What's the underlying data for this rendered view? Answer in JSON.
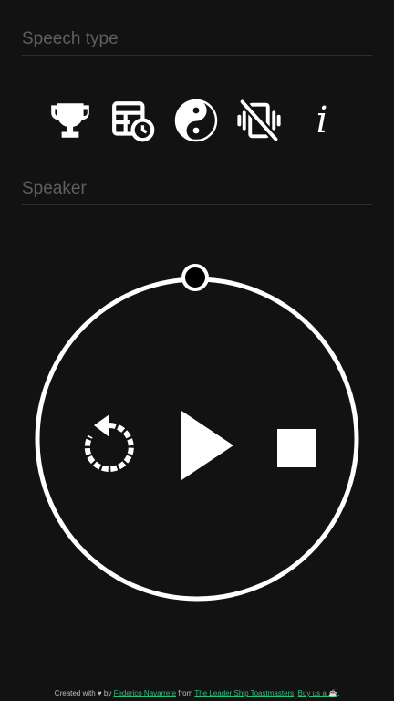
{
  "speech_type": {
    "label": "Speech type",
    "icons": [
      {
        "name": "trophy-icon"
      },
      {
        "name": "table-clock-icon"
      },
      {
        "name": "yin-yang-icon"
      },
      {
        "name": "vibrate-off-icon"
      },
      {
        "name": "info-icon",
        "glyph": "i"
      }
    ]
  },
  "speaker": {
    "label": "Speaker"
  },
  "timer": {
    "progress": 0,
    "controls": [
      "reset-icon",
      "play-icon",
      "stop-icon"
    ]
  },
  "footer": {
    "prefix": "Created with ♥ by ",
    "author_link": "Federico Navarrete",
    "from_text": " from ",
    "club_link": "The Leader Ship Toastmasters",
    "sep": ". ",
    "buy_link": "Buy us a ☕",
    "suffix": "."
  },
  "colors": {
    "background": "#121212",
    "foreground": "#ffffff",
    "label": "#5f5f5f",
    "link": "#2bbf7f"
  }
}
